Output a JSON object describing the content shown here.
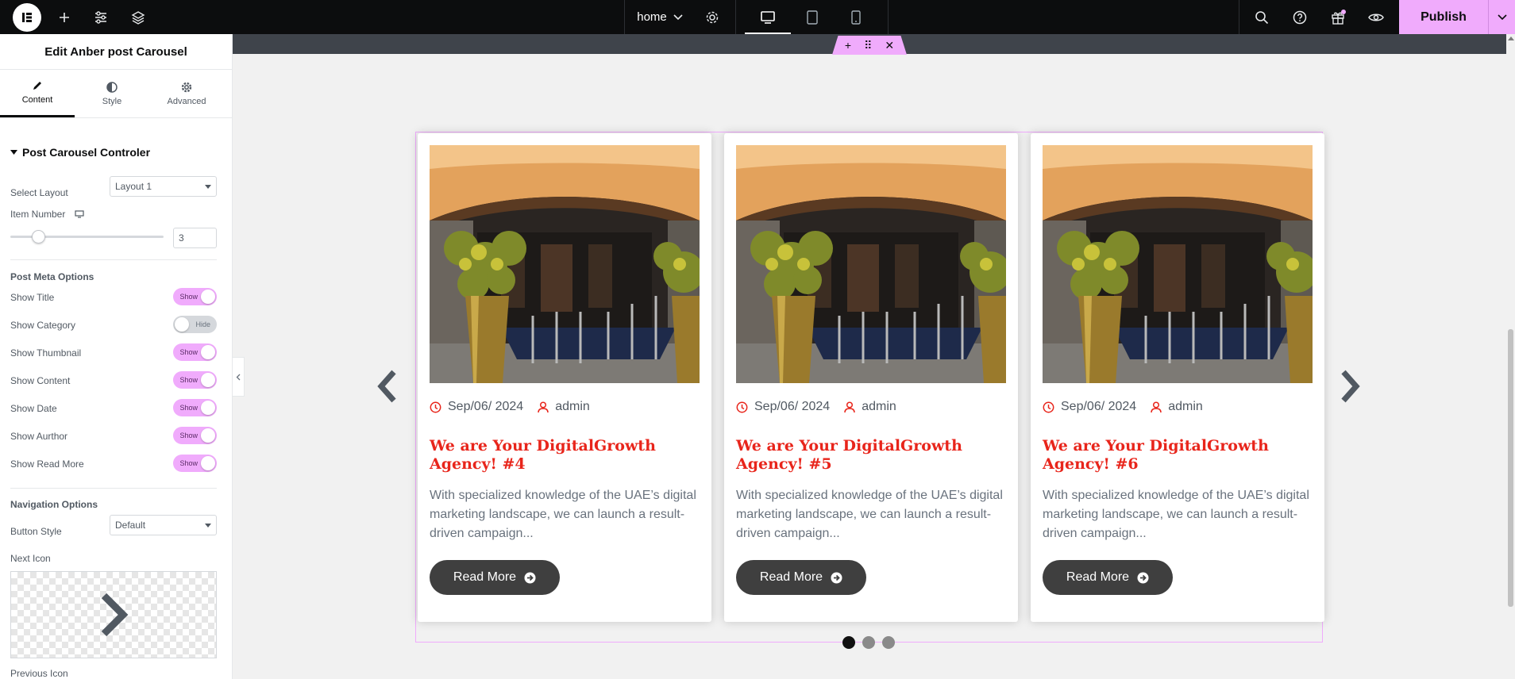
{
  "topbar": {
    "page_name": "home",
    "publish_label": "Publish"
  },
  "sidebar": {
    "title": "Edit Anber post Carousel",
    "tabs": [
      {
        "label": "Content",
        "icon": "pencil-icon"
      },
      {
        "label": "Style",
        "icon": "half-circle-icon"
      },
      {
        "label": "Advanced",
        "icon": "gear-icon"
      }
    ],
    "section_title": "Post Carousel Controler",
    "select_layout_label": "Select Layout",
    "select_layout_value": "Layout 1",
    "item_number_label": "Item Number",
    "item_number_value": "3",
    "item_number_slider_fraction": 0.18,
    "post_meta_heading": "Post Meta Options",
    "toggles": [
      {
        "label": "Show Title",
        "value": "Show",
        "on": true
      },
      {
        "label": "Show Category",
        "value": "Hide",
        "on": false
      },
      {
        "label": "Show Thumbnail",
        "value": "Show",
        "on": true
      },
      {
        "label": "Show Content",
        "value": "Show",
        "on": true
      },
      {
        "label": "Show Date",
        "value": "Show",
        "on": true
      },
      {
        "label": "Show Aurthor",
        "value": "Show",
        "on": true
      },
      {
        "label": "Show Read More",
        "value": "Show",
        "on": true
      }
    ],
    "navigation_heading": "Navigation Options",
    "button_style_label": "Button Style",
    "button_style_value": "Default",
    "next_icon_label": "Next Icon",
    "previous_icon_label": "Previous Icon"
  },
  "carousel": {
    "cards": [
      {
        "date": "Sep/06/ 2024",
        "author": "admin",
        "title": "We are Your DigitalGrowth Agency! #4",
        "excerpt": "With specialized knowledge of the UAE’s digital marketing landscape, we can launch a result-driven campaign...",
        "button": "Read More"
      },
      {
        "date": "Sep/06/ 2024",
        "author": "admin",
        "title": "We are Your DigitalGrowth Agency! #5",
        "excerpt": "With specialized knowledge of the UAE’s digital marketing landscape, we can launch a result-driven campaign...",
        "button": "Read More"
      },
      {
        "date": "Sep/06/ 2024",
        "author": "admin",
        "title": "We are Your DigitalGrowth Agency! #6",
        "excerpt": "With specialized knowledge of the UAE’s digital marketing landscape, we can launch a result-driven campaign...",
        "button": "Read More"
      }
    ],
    "active_dot": 0,
    "dot_count": 3
  },
  "colors": {
    "accent_pink": "#f0abfc",
    "title_red": "#e8251b",
    "button_dark": "#3f3f3f"
  }
}
